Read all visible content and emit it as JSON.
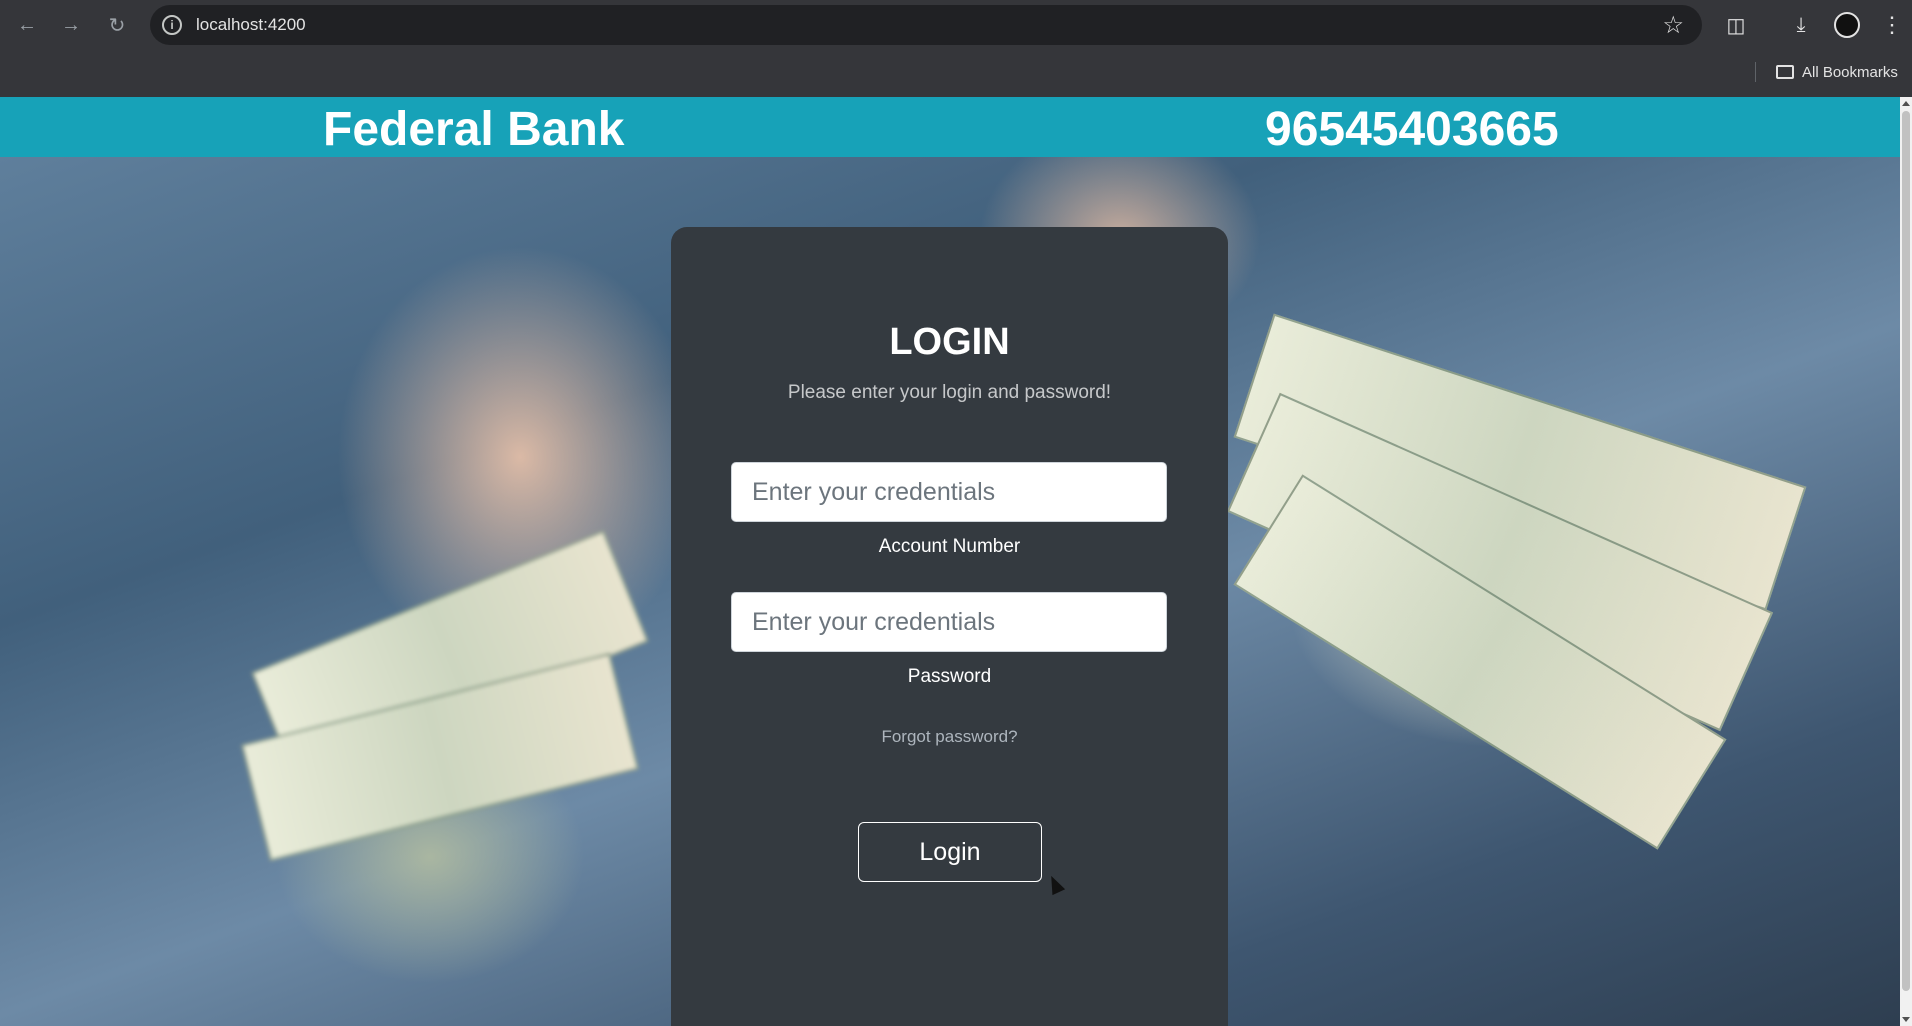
{
  "browser": {
    "url": "localhost:4200",
    "bookmarks_label": "All Bookmarks"
  },
  "header": {
    "brand": "Federal Bank",
    "phone": "96545403665",
    "color": "#17a2b8"
  },
  "login": {
    "title": "LOGIN",
    "subtitle": "Please enter your login and password!",
    "account_placeholder": "Enter your credentials",
    "account_label": "Account Number",
    "password_placeholder": "Enter your credentials",
    "password_label": "Password",
    "forgot_link": "Forgot password?",
    "submit_label": "Login",
    "card_color": "#343a40"
  }
}
